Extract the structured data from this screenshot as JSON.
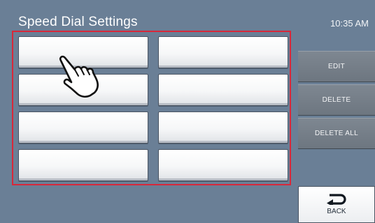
{
  "header": {
    "title": "Speed Dial Settings",
    "time": "10:35 AM"
  },
  "speed_dial_slots": [
    {
      "label": ""
    },
    {
      "label": ""
    },
    {
      "label": ""
    },
    {
      "label": ""
    },
    {
      "label": ""
    },
    {
      "label": ""
    },
    {
      "label": ""
    },
    {
      "label": ""
    }
  ],
  "side_menu": {
    "edit_label": "EDIT",
    "delete_label": "DELETE",
    "delete_all_label": "DELETE ALL"
  },
  "back": {
    "label": "BACK",
    "icon": "return-arrow-icon"
  },
  "overlay": {
    "icon": "hand-pointer-icon"
  },
  "colors": {
    "background": "#6a7f96",
    "highlight": "#d8283a"
  }
}
